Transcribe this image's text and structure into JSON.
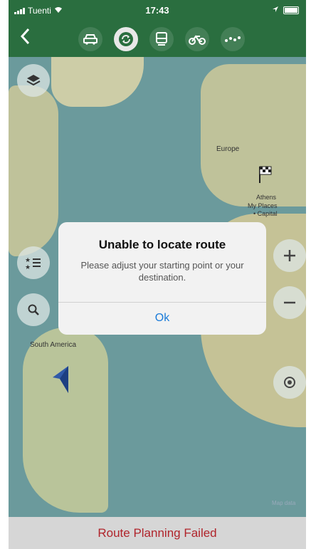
{
  "status_bar": {
    "carrier": "Tuenti",
    "time": "17:43"
  },
  "header": {
    "back_icon": "chevron-left-icon",
    "modes": [
      {
        "name": "car",
        "icon": "car-icon"
      },
      {
        "name": "any",
        "icon": "refresh-icon",
        "active": true
      },
      {
        "name": "transit",
        "icon": "train-icon"
      },
      {
        "name": "bike",
        "icon": "bicycle-icon"
      },
      {
        "name": "walk",
        "icon": "footsteps-icon"
      }
    ],
    "color": "#2a6e3f"
  },
  "map": {
    "labels": {
      "europe": "Europe",
      "athens": "Athens",
      "my_places": "My Places",
      "capital": "• Capital",
      "south_america": "South America",
      "attribution": "Map data"
    }
  },
  "dialog": {
    "title": "Unable to locate route",
    "message": "Please adjust your starting point or your destination.",
    "ok_label": "Ok"
  },
  "footer": {
    "status": "Route Planning Failed",
    "status_color": "#b0242b"
  }
}
